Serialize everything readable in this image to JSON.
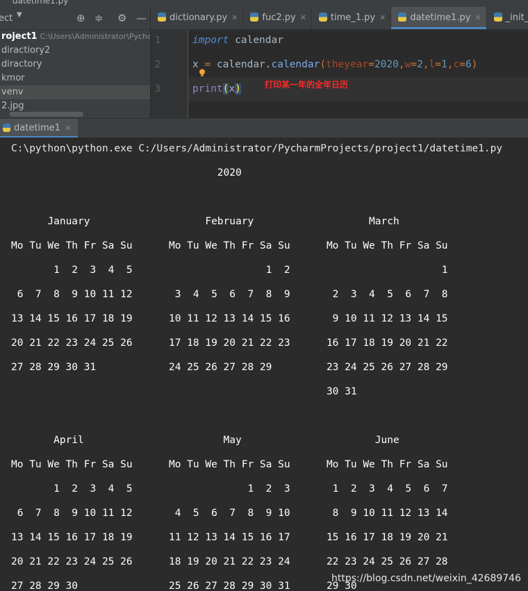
{
  "window": {
    "title": "datetime1.py"
  },
  "project_panel": {
    "header_label": "ect",
    "tree": [
      {
        "name": "roject1",
        "path": "C:\\Users\\Administrator\\Pycharr",
        "selected": false,
        "root": true
      },
      {
        "name": "diractiory2",
        "selected": false
      },
      {
        "name": "diractory",
        "selected": false
      },
      {
        "name": "kmor",
        "selected": false
      },
      {
        "name": "venv",
        "selected": true
      },
      {
        "name": "2.jpg",
        "selected": false
      }
    ]
  },
  "editor_tabs": [
    {
      "label": "dictionary.py",
      "active": false
    },
    {
      "label": "fuc2.py",
      "active": false
    },
    {
      "label": "time_1.py",
      "active": false
    },
    {
      "label": "datetime1.py",
      "active": true
    },
    {
      "label": "_init_.py",
      "active": false
    }
  ],
  "code": {
    "line_numbers": [
      "1",
      "2",
      "3"
    ],
    "line1": {
      "keyword": "import",
      "module": "calendar"
    },
    "line2": {
      "var": "x",
      "eq": " = ",
      "obj": "calendar.",
      "call": "calendar",
      "open": "(",
      "p1": "theyear",
      "v1": "2020",
      "p2": "w",
      "v2": "2",
      "p3": "l",
      "v3": "1",
      "p4": "c",
      "v4": "6",
      "close": ")"
    },
    "line3": {
      "call": "print",
      "open": "(",
      "arg": "x",
      "close": ")"
    },
    "annotation": "打印某一年的全年日历"
  },
  "run_panel": {
    "tab_label": "datetime1",
    "command": "C:\\python\\python.exe C:/Users/Administrator/PycharmProjects/project1/datetime1.py",
    "year": "                                  2020",
    "lines": [
      "",
      "      January                   February                   March",
      "Mo Tu We Th Fr Sa Su      Mo Tu We Th Fr Sa Su      Mo Tu We Th Fr Sa Su",
      "       1  2  3  4  5                      1  2                         1",
      " 6  7  8  9 10 11 12       3  4  5  6  7  8  9       2  3  4  5  6  7  8",
      "13 14 15 16 17 18 19      10 11 12 13 14 15 16       9 10 11 12 13 14 15",
      "20 21 22 23 24 25 26      17 18 19 20 21 22 23      16 17 18 19 20 21 22",
      "27 28 29 30 31            24 25 26 27 28 29         23 24 25 26 27 28 29",
      "                                                    30 31",
      "",
      "       April                       May                      June",
      "Mo Tu We Th Fr Sa Su      Mo Tu We Th Fr Sa Su      Mo Tu We Th Fr Sa Su",
      "       1  2  3  4  5                   1  2  3       1  2  3  4  5  6  7",
      " 6  7  8  9 10 11 12       4  5  6  7  8  9 10       8  9 10 11 12 13 14",
      "13 14 15 16 17 18 19      11 12 13 14 15 16 17      15 16 17 18 19 20 21",
      "20 21 22 23 24 25 26      18 19 20 21 22 23 24      22 23 24 25 26 27 28",
      "27 28 29 30               25 26 27 28 29 30 31      29 30"
    ]
  },
  "watermark": "https://blog.csdn.net/weixin_42689746",
  "colors": {
    "accent": "#4a88c7",
    "annotation": "#ff2a2a",
    "keyword": "#cc7832",
    "number": "#6897bb",
    "param": "#aa4926"
  }
}
